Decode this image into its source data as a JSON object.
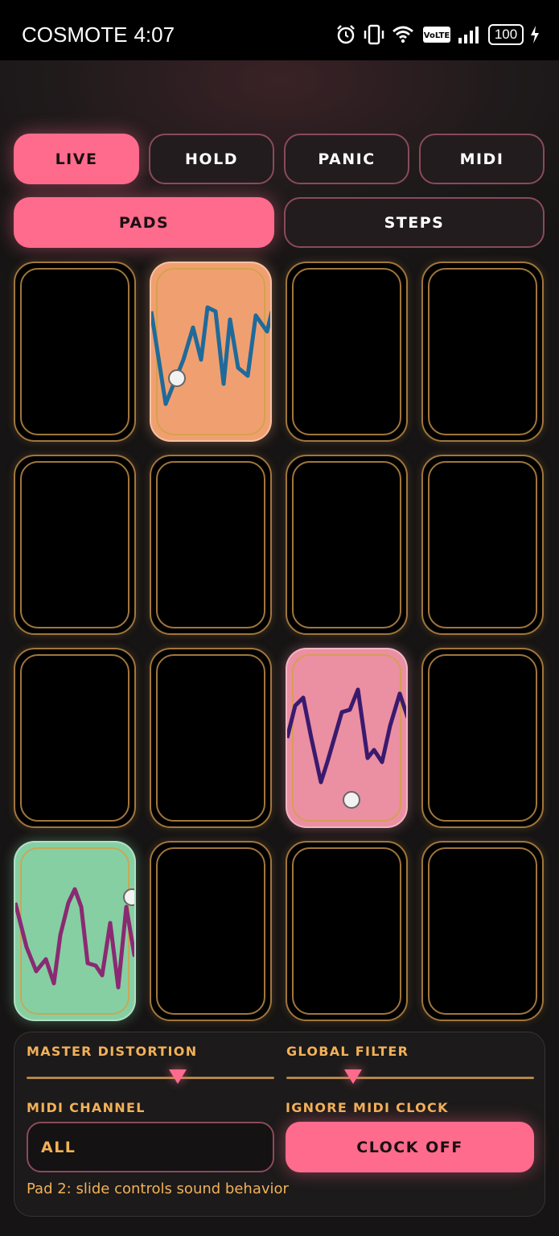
{
  "status_bar": {
    "carrier": "COSMOTE",
    "time": "4:07",
    "battery": "100",
    "icons": [
      "alarm-icon",
      "vibrate-icon",
      "wifi-icon",
      "volte-icon",
      "signal-icon",
      "battery-icon",
      "charging-icon"
    ]
  },
  "mode_buttons": [
    {
      "label": "LIVE",
      "active": true
    },
    {
      "label": "HOLD",
      "active": false
    },
    {
      "label": "PANIC",
      "active": false
    },
    {
      "label": "MIDI",
      "active": false
    }
  ],
  "view_tabs": [
    {
      "label": "PADS",
      "active": true
    },
    {
      "label": "STEPS",
      "active": false
    }
  ],
  "pads": [
    {
      "index": 1,
      "active": false
    },
    {
      "index": 2,
      "active": true,
      "color": "#f0a070",
      "wave_color": "#1f6a9a"
    },
    {
      "index": 3,
      "active": false
    },
    {
      "index": 4,
      "active": false
    },
    {
      "index": 5,
      "active": false
    },
    {
      "index": 6,
      "active": false
    },
    {
      "index": 7,
      "active": false
    },
    {
      "index": 8,
      "active": false
    },
    {
      "index": 9,
      "active": false
    },
    {
      "index": 10,
      "active": false
    },
    {
      "index": 11,
      "active": true,
      "color": "#eb8fa2",
      "wave_color": "#3a1a6e"
    },
    {
      "index": 12,
      "active": false
    },
    {
      "index": 13,
      "active": true,
      "color": "#86cfa3",
      "wave_color": "#8a2a72"
    },
    {
      "index": 14,
      "active": false
    },
    {
      "index": 15,
      "active": false
    },
    {
      "index": 16,
      "active": false
    }
  ],
  "controls": {
    "master_distortion": {
      "label": "MASTER DISTORTION",
      "value": 0.61
    },
    "global_filter": {
      "label": "GLOBAL FILTER",
      "value": 0.27
    },
    "midi_channel": {
      "label": "MIDI CHANNEL",
      "value": "ALL"
    },
    "midi_clock": {
      "label": "IGNORE MIDI CLOCK",
      "button": "CLOCK OFF"
    },
    "hint": "Pad 2: slide controls sound behavior"
  },
  "colors": {
    "accent": "#ff6b8c",
    "label": "#f2b158",
    "pad_border": "#a0763c"
  }
}
